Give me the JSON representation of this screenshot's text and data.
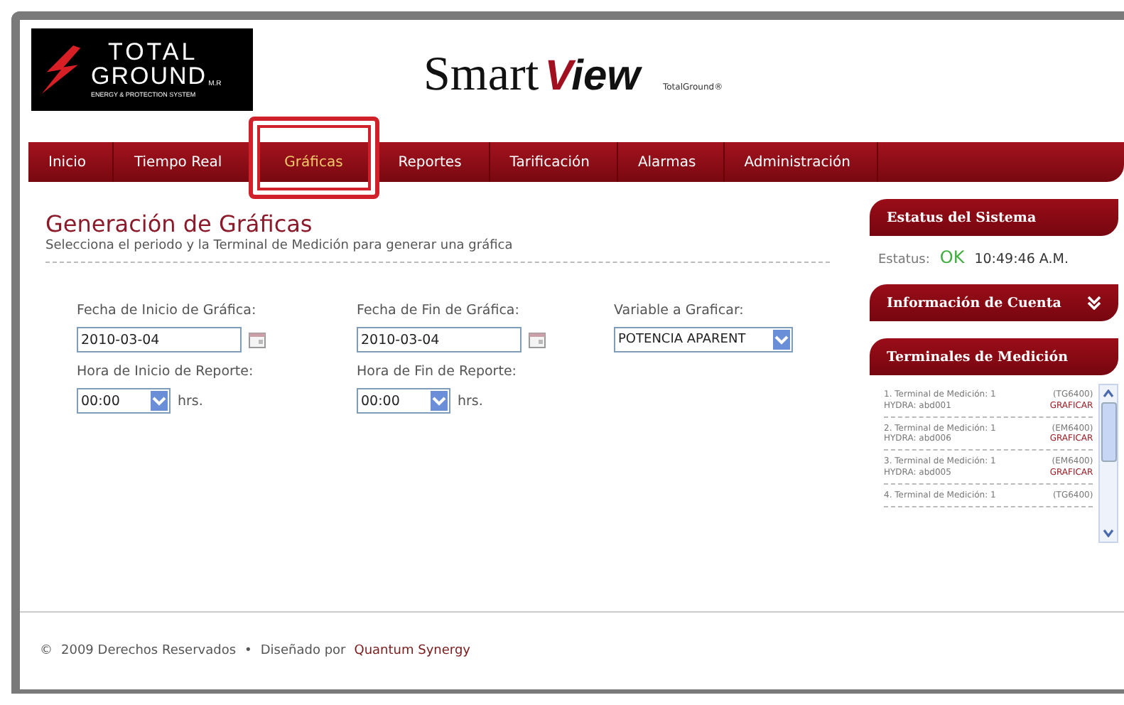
{
  "logo": {
    "line1": "TOTAL",
    "line2": "GROUND",
    "mark": "M.R",
    "tagline": "ENERGY & PROTECTION SYSTEM"
  },
  "brand": {
    "word1": "Smart",
    "word2": "View",
    "small": "TotalGround®"
  },
  "nav": [
    {
      "label": "Inicio",
      "selected": false
    },
    {
      "label": "Tiempo Real",
      "selected": false
    },
    {
      "label": "Gráficas",
      "selected": true
    },
    {
      "label": "Reportes",
      "selected": false
    },
    {
      "label": "Tarificación",
      "selected": false
    },
    {
      "label": "Alarmas",
      "selected": false
    },
    {
      "label": "Administración",
      "selected": false
    }
  ],
  "page": {
    "title": "Generación de Gráficas",
    "subtitle": "Selecciona el periodo y la Terminal de Medición para generar una gráfica"
  },
  "form": [
    {
      "kind": "date",
      "label": "Fecha de Inicio de Gráfica:",
      "value": "2010-03-04"
    },
    {
      "kind": "date",
      "label": "Fecha de Fin de Gráfica:",
      "value": "2010-03-04"
    },
    {
      "kind": "select",
      "label": "Variable a Graficar:",
      "value": "POTENCIA APARENT"
    },
    {
      "kind": "time",
      "label": "Hora de Inicio de Reporte:",
      "value": "00:00",
      "unit": "hrs."
    },
    {
      "kind": "time",
      "label": "Hora de Fin de Reporte:",
      "value": "00:00",
      "unit": "hrs."
    }
  ],
  "sidebar": {
    "status": {
      "title": "Estatus del Sistema",
      "label": "Estatus:",
      "value": "OK",
      "time": "10:49:46 A.M."
    },
    "account": {
      "title": "Información de Cuenta",
      "expanded": false
    },
    "terminals": {
      "title": "Terminales de Medición",
      "items": [
        {
          "name": "1. Terminal de Medición: 1",
          "model": "(TG6400)",
          "detail": "HYDRA: abd001",
          "action": "GRAFICAR"
        },
        {
          "name": "2. Terminal de Medición: 1",
          "model": "(EM6400)",
          "detail": "HYDRA: abd006",
          "action": "GRAFICAR"
        },
        {
          "name": "3. Terminal de Medición: 1",
          "model": "(EM6400)",
          "detail": "HYDRA: abd005",
          "action": "GRAFICAR"
        },
        {
          "name": "4. Terminal de Medición: 1",
          "model": "(TG6400)"
        }
      ]
    }
  },
  "footer": {
    "copyright": "©",
    "text": "2009 Derechos Reservados",
    "separator": "•",
    "credit": "Diseñado por",
    "link": "Quantum Synergy"
  }
}
